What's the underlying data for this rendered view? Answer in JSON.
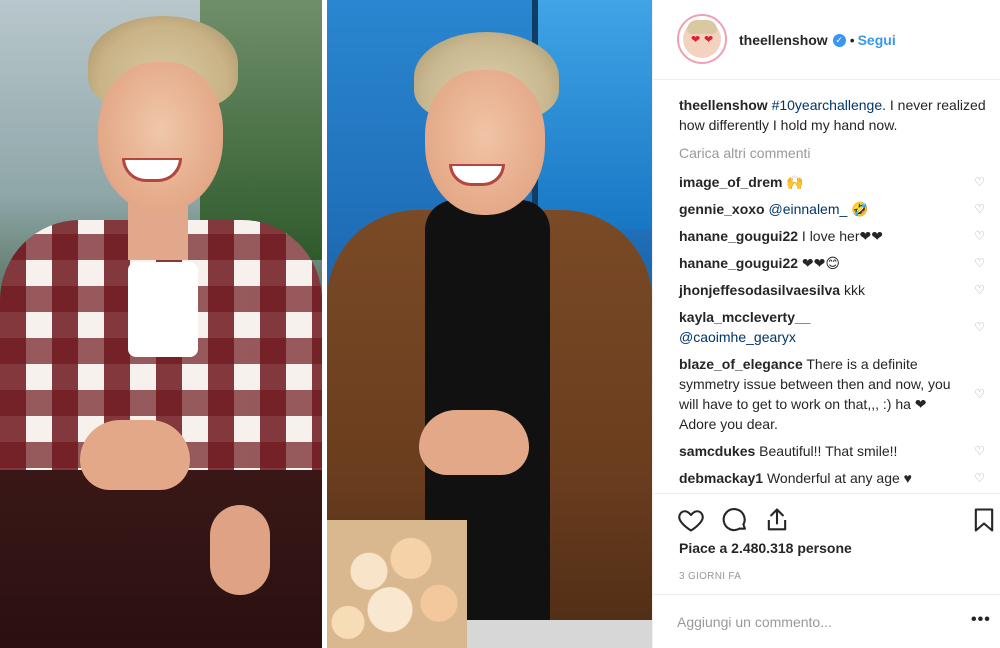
{
  "post": {
    "username": "theellenshow",
    "verified": true,
    "separator": "•",
    "follow_label": "Segui",
    "caption_hashtag": "#10yearchallenge",
    "caption_text": ". I never realized how differently I hold my hand now.",
    "load_more_label": "Carica altri commenti",
    "likes_label": "Piace a 2.480.318 persone",
    "date_label": "3 GIORNI FA",
    "add_comment_placeholder": "Aggiungi un commento...",
    "more_label": "•••"
  },
  "comments": [
    {
      "user": "image_of_drem",
      "text": "🙌"
    },
    {
      "user": "gennie_xoxo",
      "text": "@einnalem_ 🤣"
    },
    {
      "user": "hanane_gougui22",
      "text": "I love her❤❤"
    },
    {
      "user": "hanane_gougui22",
      "text": "❤❤😊"
    },
    {
      "user": "jhonjeffesodasilvaesilva",
      "text": "kkk"
    },
    {
      "user": "kayla_mccleverty__",
      "text": "@caoimhe_gearyx"
    },
    {
      "user": "blaze_of_elegance",
      "text": "There is a definite symmetry issue between then and now, you will have to get to work on that,,, :) ha ❤ Adore you dear."
    },
    {
      "user": "samcdukes",
      "text": "Beautiful!! That smile!!"
    },
    {
      "user": "debmackay1",
      "text": "Wonderful at any age ♥"
    }
  ],
  "colors": {
    "link_blue": "#3897f0",
    "hashtag_blue": "#003569",
    "muted_gray": "#999999",
    "text": "#262626"
  },
  "icons": [
    "verified-badge-icon",
    "heart-icon",
    "comment-icon",
    "share-icon",
    "bookmark-icon",
    "comment-like-icon"
  ]
}
